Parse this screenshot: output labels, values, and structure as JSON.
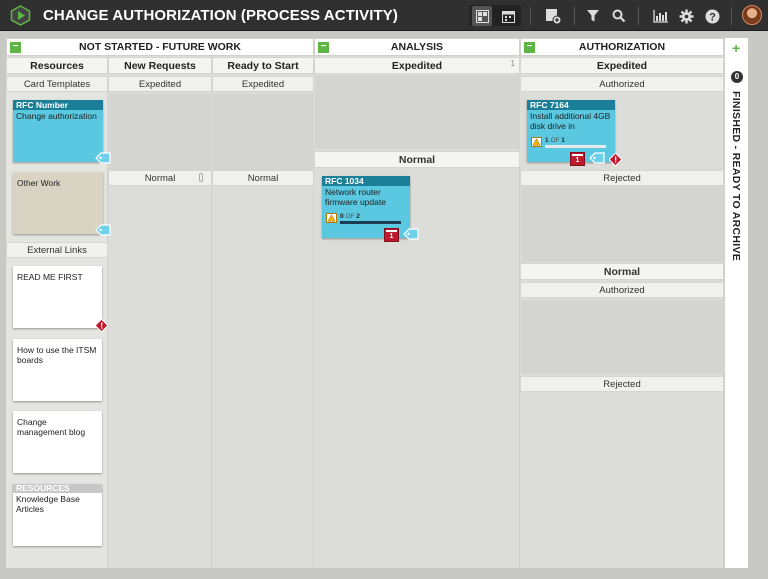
{
  "app": {
    "title": "CHANGE AUTHORIZATION (PROCESS ACTIVITY)"
  },
  "toolbar": {
    "icons": [
      "board-view-icon",
      "calendar-view-icon",
      "add-card-icon",
      "filter-icon",
      "search-icon",
      "analytics-icon",
      "settings-icon",
      "help-icon",
      "user-avatar"
    ]
  },
  "lanes": {
    "not_started": {
      "title": "NOT STARTED - FUTURE WORK",
      "resources": {
        "title": "Resources",
        "card_templates": "Card Templates",
        "external_links": "External Links",
        "rfc_card": {
          "id": "RFC Number",
          "text": "Change authorization"
        },
        "other_work": {
          "text": "Other Work"
        },
        "links": [
          {
            "text": "READ ME FIRST"
          },
          {
            "text": "How to use the ITSM boards"
          },
          {
            "text": "Change management blog"
          }
        ],
        "resource_card": {
          "head": "RESOURCES",
          "text": "Knowledge Base Articles"
        }
      },
      "new_requests": {
        "title": "New Requests",
        "expedited": "Expedited",
        "normal": "Normal"
      },
      "ready_to_start": {
        "title": "Ready to Start",
        "expedited": "Expedited",
        "normal": "Normal"
      }
    },
    "analysis": {
      "title": "ANALYSIS",
      "expedited": "Expedited",
      "expedited_count": "1",
      "normal": "Normal",
      "card": {
        "id": "RFC 1034",
        "text": "Network router firmware update",
        "progress_done": "0",
        "progress_of": "OF",
        "progress_total": "2",
        "progress_fraction": 0,
        "calendar": "1"
      }
    },
    "authorization": {
      "title": "AUTHORIZATION",
      "expedited": "Expedited",
      "authorized": "Authorized",
      "rejected": "Rejected",
      "normal": "Normal",
      "authorized_2": "Authorized",
      "rejected_2": "Rejected",
      "card": {
        "id": "RFC 7164",
        "text": "Install additional 4GB disk drive in",
        "progress_done": "1",
        "progress_of": "OF",
        "progress_total": "1",
        "progress_fraction": 1,
        "calendar": "1"
      }
    },
    "finished": {
      "title": "FINISHED - READY TO ARCHIVE",
      "count": "0",
      "add": "+"
    }
  },
  "colors": {
    "accent_green": "#5db543",
    "card_cyan": "#5ac8e0",
    "card_header": "#1a7f97",
    "alert_red": "#c0182c",
    "topbar": "#303030"
  }
}
